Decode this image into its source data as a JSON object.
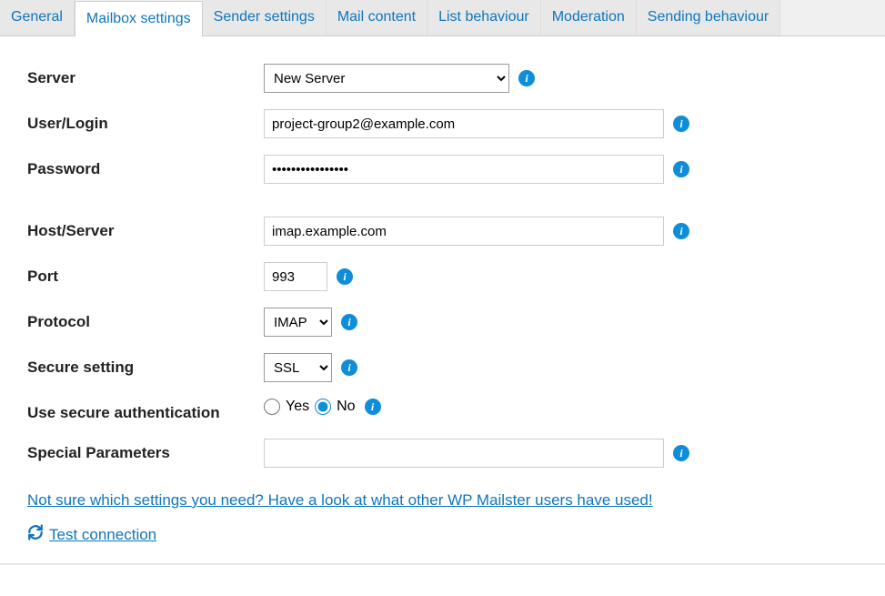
{
  "tabs": [
    {
      "label": "General",
      "active": false
    },
    {
      "label": "Mailbox settings",
      "active": true
    },
    {
      "label": "Sender settings",
      "active": false
    },
    {
      "label": "Mail content",
      "active": false
    },
    {
      "label": "List behaviour",
      "active": false
    },
    {
      "label": "Moderation",
      "active": false
    },
    {
      "label": "Sending behaviour",
      "active": false
    }
  ],
  "labels": {
    "server": "Server",
    "user_login": "User/Login",
    "password": "Password",
    "host_server": "Host/Server",
    "port": "Port",
    "protocol": "Protocol",
    "secure_setting": "Secure setting",
    "use_secure_auth": "Use secure authentication",
    "special_parameters": "Special Parameters"
  },
  "values": {
    "server": "New Server",
    "user_login": "project-group2@example.com",
    "password": "••••••••••••••••",
    "host_server": "imap.example.com",
    "port": "993",
    "protocol": "IMAP",
    "secure_setting": "SSL",
    "use_secure_auth": "No",
    "special_parameters": ""
  },
  "radio": {
    "yes": "Yes",
    "no": "No"
  },
  "links": {
    "help": "Not sure which settings you need? Have a look at what other WP Mailster users have used!",
    "test": "Test connection"
  }
}
